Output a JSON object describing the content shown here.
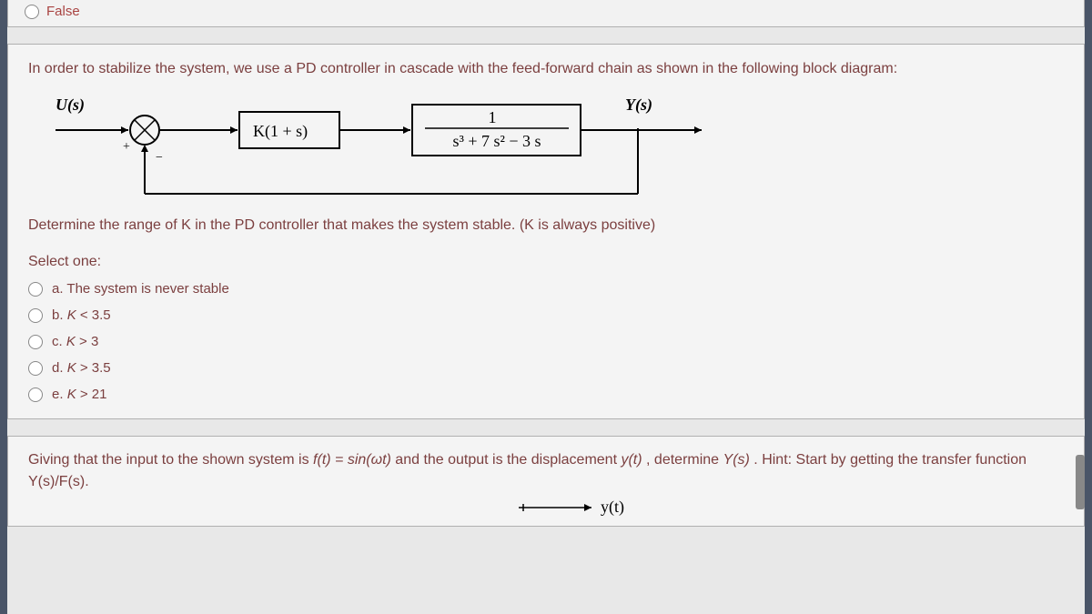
{
  "prev_option": {
    "label": "False"
  },
  "question": {
    "stem": "In order to stabilize the system, we use a PD controller in cascade with the feed-forward chain as shown in the following block diagram:",
    "diagram": {
      "input": "U(s)",
      "output": "Y(s)",
      "block1": "K(1 + s)",
      "block2_num": "1",
      "block2_den": "s³ + 7 s² − 3 s",
      "sum_plus": "+",
      "sum_minus": "−"
    },
    "determine": "Determine the range of K in the PD controller that makes the system stable. (K is always positive)",
    "select_one": "Select one:",
    "options": [
      {
        "key": "a",
        "text": "a. The system is never stable"
      },
      {
        "key": "b",
        "text": "b. K < 3.5"
      },
      {
        "key": "c",
        "text": "c. K > 3"
      },
      {
        "key": "d",
        "text": "d. K > 3.5"
      },
      {
        "key": "e",
        "text": "e. K > 21"
      }
    ]
  },
  "next_question": {
    "text_before": "Giving that the input to the shown system is ",
    "ft": "f(t) = sin(ωt)",
    "text_mid1": " and the output is the displacement ",
    "yt": "y(t)",
    "text_mid2": ", determine ",
    "ys": "Y(s)",
    "text_after": ". Hint: Start by getting the transfer function Y(s)/F(s).",
    "diag_out": "y(t)"
  }
}
